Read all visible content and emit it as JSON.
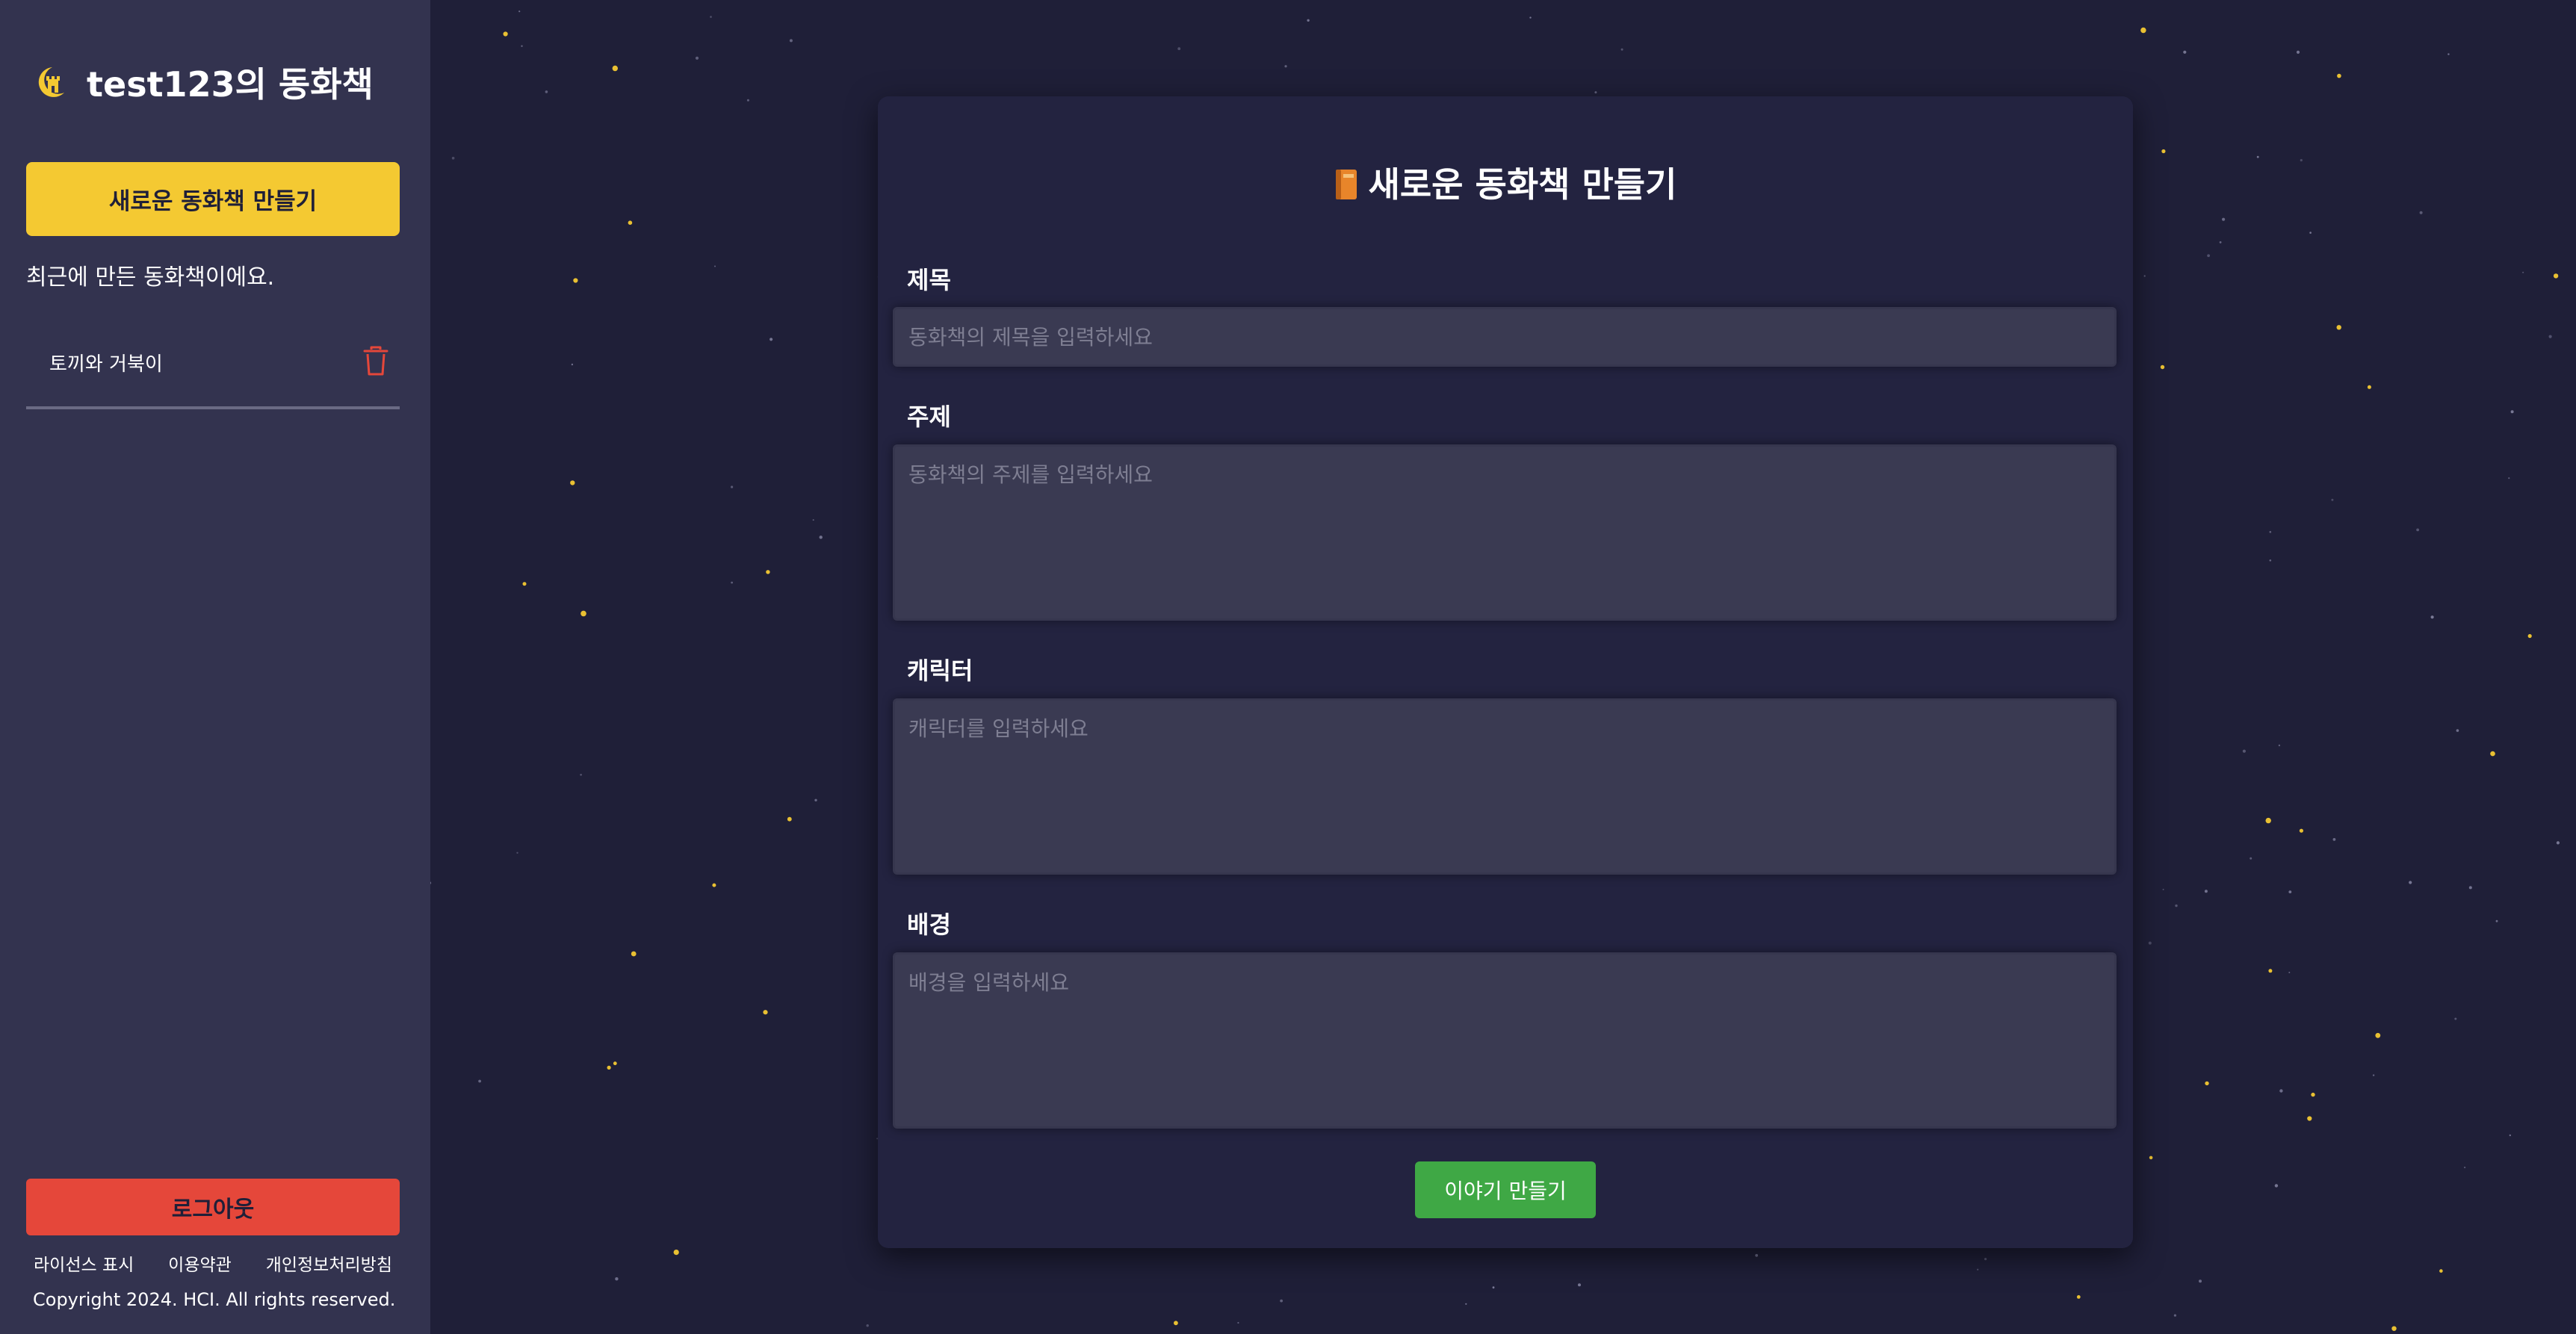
{
  "sidebar": {
    "brand_title": "test123의 동화책",
    "new_book_label": "새로운 동화책 만들기",
    "recent_caption": "최근에 만든 동화책이에요.",
    "books": [
      {
        "title": "토끼와 거북이"
      }
    ],
    "logout_label": "로그아웃",
    "footer_links": [
      "라이선스 표시",
      "이용약관",
      "개인정보처리방침"
    ],
    "copyright": "Copyright 2024. HCI. All rights reserved."
  },
  "form": {
    "title": "새로운 동화책 만들기",
    "fields": {
      "title": {
        "label": "제목",
        "value": "",
        "placeholder": "동화책의 제목을 입력하세요"
      },
      "topic": {
        "label": "주제",
        "value": "",
        "placeholder": "동화책의 주제를 입력하세요"
      },
      "characters": {
        "label": "캐릭터",
        "value": "",
        "placeholder": "캐릭터를 입력하세요"
      },
      "background": {
        "label": "배경",
        "value": "",
        "placeholder": "배경을 입력하세요"
      }
    },
    "submit_label": "이야기 만들기"
  },
  "colors": {
    "background": "#1f1f38",
    "sidebar": "#33334f",
    "card": "#232340",
    "input": "#3a3a52",
    "accent_yellow": "#f4c932",
    "danger_red": "#e5473a",
    "submit_green": "#3fa845",
    "star_yellow": "#f4c932"
  },
  "icons": {
    "brand": "moon-castle-icon",
    "heading": "book-icon",
    "delete": "trash-icon"
  }
}
